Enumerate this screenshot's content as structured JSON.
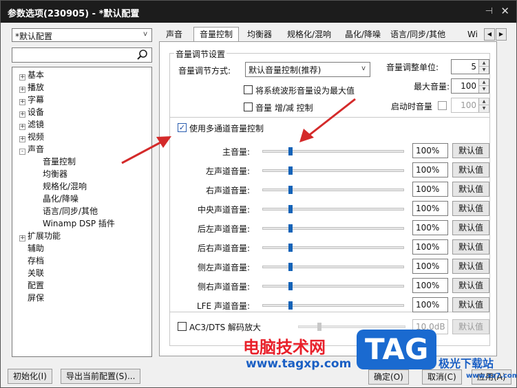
{
  "window": {
    "title": "参数选项(230905) - *默认配置"
  },
  "left": {
    "preset": "*默认配置",
    "search_value": "",
    "tree": [
      {
        "label": "基本",
        "level": 0,
        "expander": "+"
      },
      {
        "label": "播放",
        "level": 0,
        "expander": "+"
      },
      {
        "label": "字幕",
        "level": 0,
        "expander": "+"
      },
      {
        "label": "设备",
        "level": 0,
        "expander": "+"
      },
      {
        "label": "滤镜",
        "level": 0,
        "expander": "+"
      },
      {
        "label": "视频",
        "level": 0,
        "expander": "+"
      },
      {
        "label": "声音",
        "level": 0,
        "expander": "-"
      },
      {
        "label": "音量控制",
        "level": 1,
        "expander": ""
      },
      {
        "label": "均衡器",
        "level": 1,
        "expander": ""
      },
      {
        "label": "规格化/混响",
        "level": 1,
        "expander": ""
      },
      {
        "label": "晶化/降噪",
        "level": 1,
        "expander": ""
      },
      {
        "label": "语言/同步/其他",
        "level": 1,
        "expander": ""
      },
      {
        "label": "Winamp DSP 插件",
        "level": 1,
        "expander": ""
      },
      {
        "label": "扩展功能",
        "level": 0,
        "expander": "+"
      },
      {
        "label": "辅助",
        "level": 0,
        "expander": ""
      },
      {
        "label": "存档",
        "level": 0,
        "expander": ""
      },
      {
        "label": "关联",
        "level": 0,
        "expander": ""
      },
      {
        "label": "配置",
        "level": 0,
        "expander": ""
      },
      {
        "label": "屏保",
        "level": 0,
        "expander": ""
      }
    ]
  },
  "tabs": [
    "声音",
    "音量控制",
    "均衡器",
    "规格化/混响",
    "晶化/降噪",
    "语言/同步/其他",
    "Wi"
  ],
  "active_tab": 1,
  "volume": {
    "group_title": "音量调节设置",
    "mode_label": "音量调节方式:",
    "mode_value": "默认音量控制(推荐)",
    "waveform_max_label": "将系统波形音量设为最大值",
    "inc_dec_label": "音量 增/减 控制",
    "unit_label": "音量调整单位:",
    "unit_value": "5",
    "max_label": "最大音量:",
    "max_value": "100",
    "startup_label": "启动时音量",
    "startup_value": "100",
    "multichannel_label": "使用多通道音量控制",
    "multichannel_checked": true,
    "channels": [
      {
        "label": "主音量:",
        "value": "100%",
        "level": 0.2
      },
      {
        "label": "左声道音量:",
        "value": "100%",
        "level": 0.2
      },
      {
        "label": "右声道音量:",
        "value": "100%",
        "level": 0.2
      },
      {
        "label": "中央声道音量:",
        "value": "100%",
        "level": 0.2
      },
      {
        "label": "后左声道音量:",
        "value": "100%",
        "level": 0.2
      },
      {
        "label": "后右声道音量:",
        "value": "100%",
        "level": 0.2
      },
      {
        "label": "侧左声道音量:",
        "value": "100%",
        "level": 0.2
      },
      {
        "label": "侧右声道音量:",
        "value": "100%",
        "level": 0.2
      },
      {
        "label": "LFE 声道音量:",
        "value": "100%",
        "level": 0.2
      }
    ],
    "default_label": "默认值",
    "ac3_label": "AC3/DTS 解码放大",
    "ac3_value": "10.0dB",
    "ac3_level": 0.2
  },
  "bottom": {
    "init_label": "初始化(I)",
    "export_label": "导出当前配置(S)...",
    "ok_label": "确定(O)",
    "cancel_label": "取消(C)",
    "apply_label": "应用(A)"
  },
  "watermark": {
    "cn_text": "电脑技术网",
    "url": "www.tagxp.com",
    "logo": "TAG",
    "right_text": "极光下载站",
    "right_url": "www.xz7.com"
  },
  "colors": {
    "titlebar": "#1c1c1c",
    "accent": "#1463b8",
    "arrow": "#d42a2a",
    "watermark_red": "#e8202a",
    "watermark_blue": "#1a5fc4"
  }
}
